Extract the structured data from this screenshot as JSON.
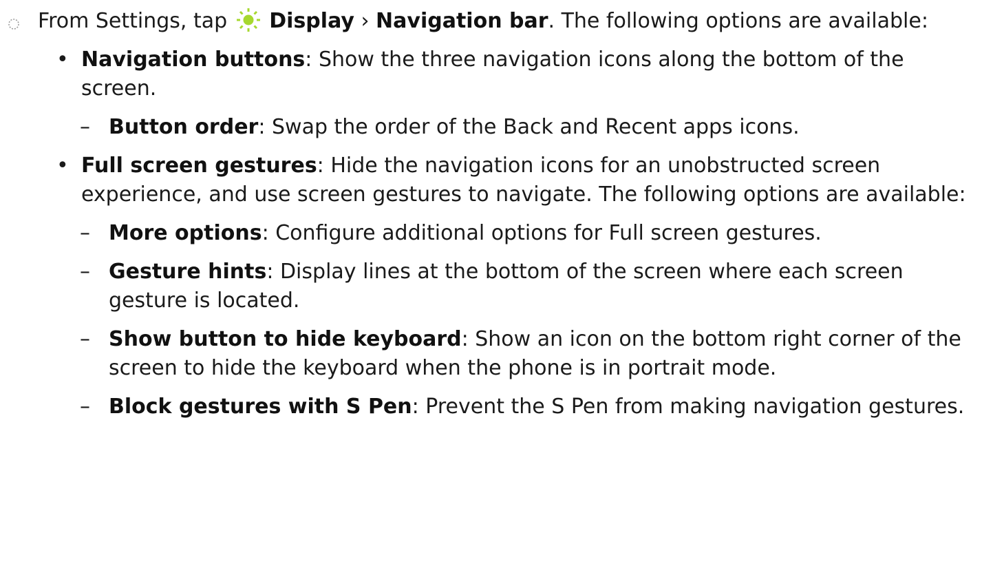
{
  "intro": {
    "prefix": "From Settings, tap",
    "icon": "display-sun-icon",
    "path_first": "Display",
    "path_sep": "›",
    "path_second": "Navigation bar",
    "suffix": ". The following options are available:"
  },
  "colors": {
    "icon_green": "#a6d82e",
    "text": "#1a1a1a",
    "marker": "#9a9a9a"
  },
  "items": [
    {
      "level": 1,
      "bullet": "•",
      "term": "Navigation buttons",
      "desc": ": Show the three navigation icons along the bottom of the screen."
    },
    {
      "level": 2,
      "bullet": "–",
      "term": "Button order",
      "desc": ": Swap the order of the Back and Recent apps icons."
    },
    {
      "level": 1,
      "bullet": "•",
      "term": "Full screen gestures",
      "desc": ": Hide the navigation icons for an unobstructed screen experience, and use screen gestures to navigate. The following options are available:"
    },
    {
      "level": 2,
      "bullet": "–",
      "term": "More options",
      "desc": ": Configure additional options for Full screen gestures."
    },
    {
      "level": 2,
      "bullet": "–",
      "term": "Gesture hints",
      "desc": ": Display lines at the bottom of the screen where each screen gesture is located."
    },
    {
      "level": 2,
      "bullet": "–",
      "term": "Show button to hide keyboard",
      "desc": ": Show an icon on the bottom right corner of the screen to hide the keyboard when the phone is in portrait mode."
    },
    {
      "level": 2,
      "bullet": "–",
      "term": "Block gestures with S Pen",
      "desc": ": Prevent the S Pen from making navigation gestures."
    }
  ]
}
